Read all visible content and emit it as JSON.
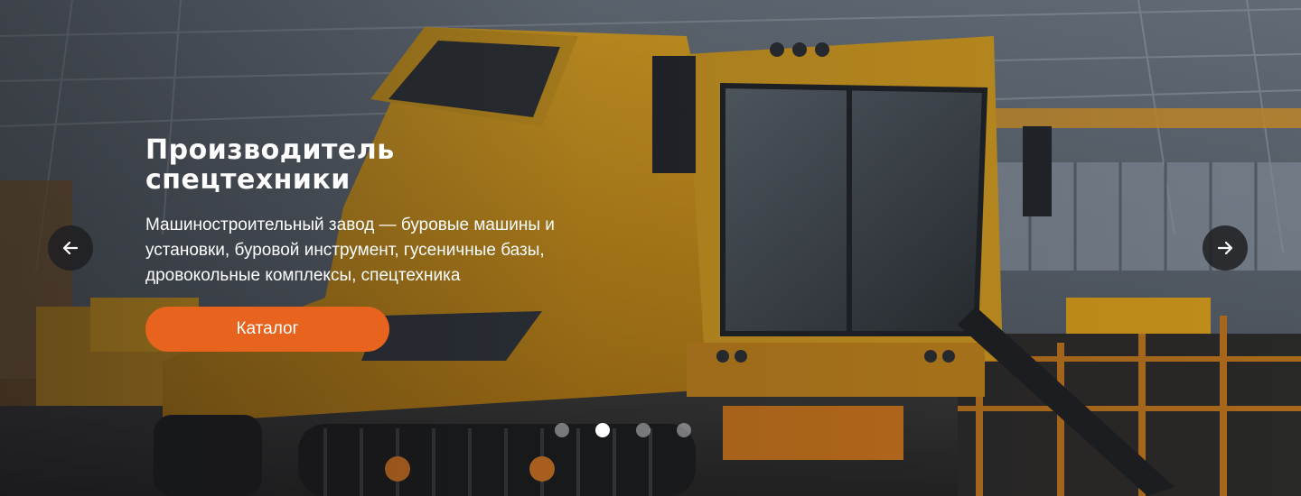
{
  "hero": {
    "title_line1": "Производитель",
    "title_line2": "спецтехники",
    "subtitle": "Машиностроительный завод — буровые машины и установки, буровой инструмент, гусеничные базы, дровокольные комплексы, спецтехника",
    "cta_label": "Каталог"
  },
  "slider": {
    "prev_icon": "arrow-left-icon",
    "next_icon": "arrow-right-icon",
    "slide_count": 4,
    "active_slide": 2
  },
  "colors": {
    "accent": "#e8641e",
    "machine_yellow": "#e0a21a",
    "arrow_bg": "#1e1e22"
  }
}
